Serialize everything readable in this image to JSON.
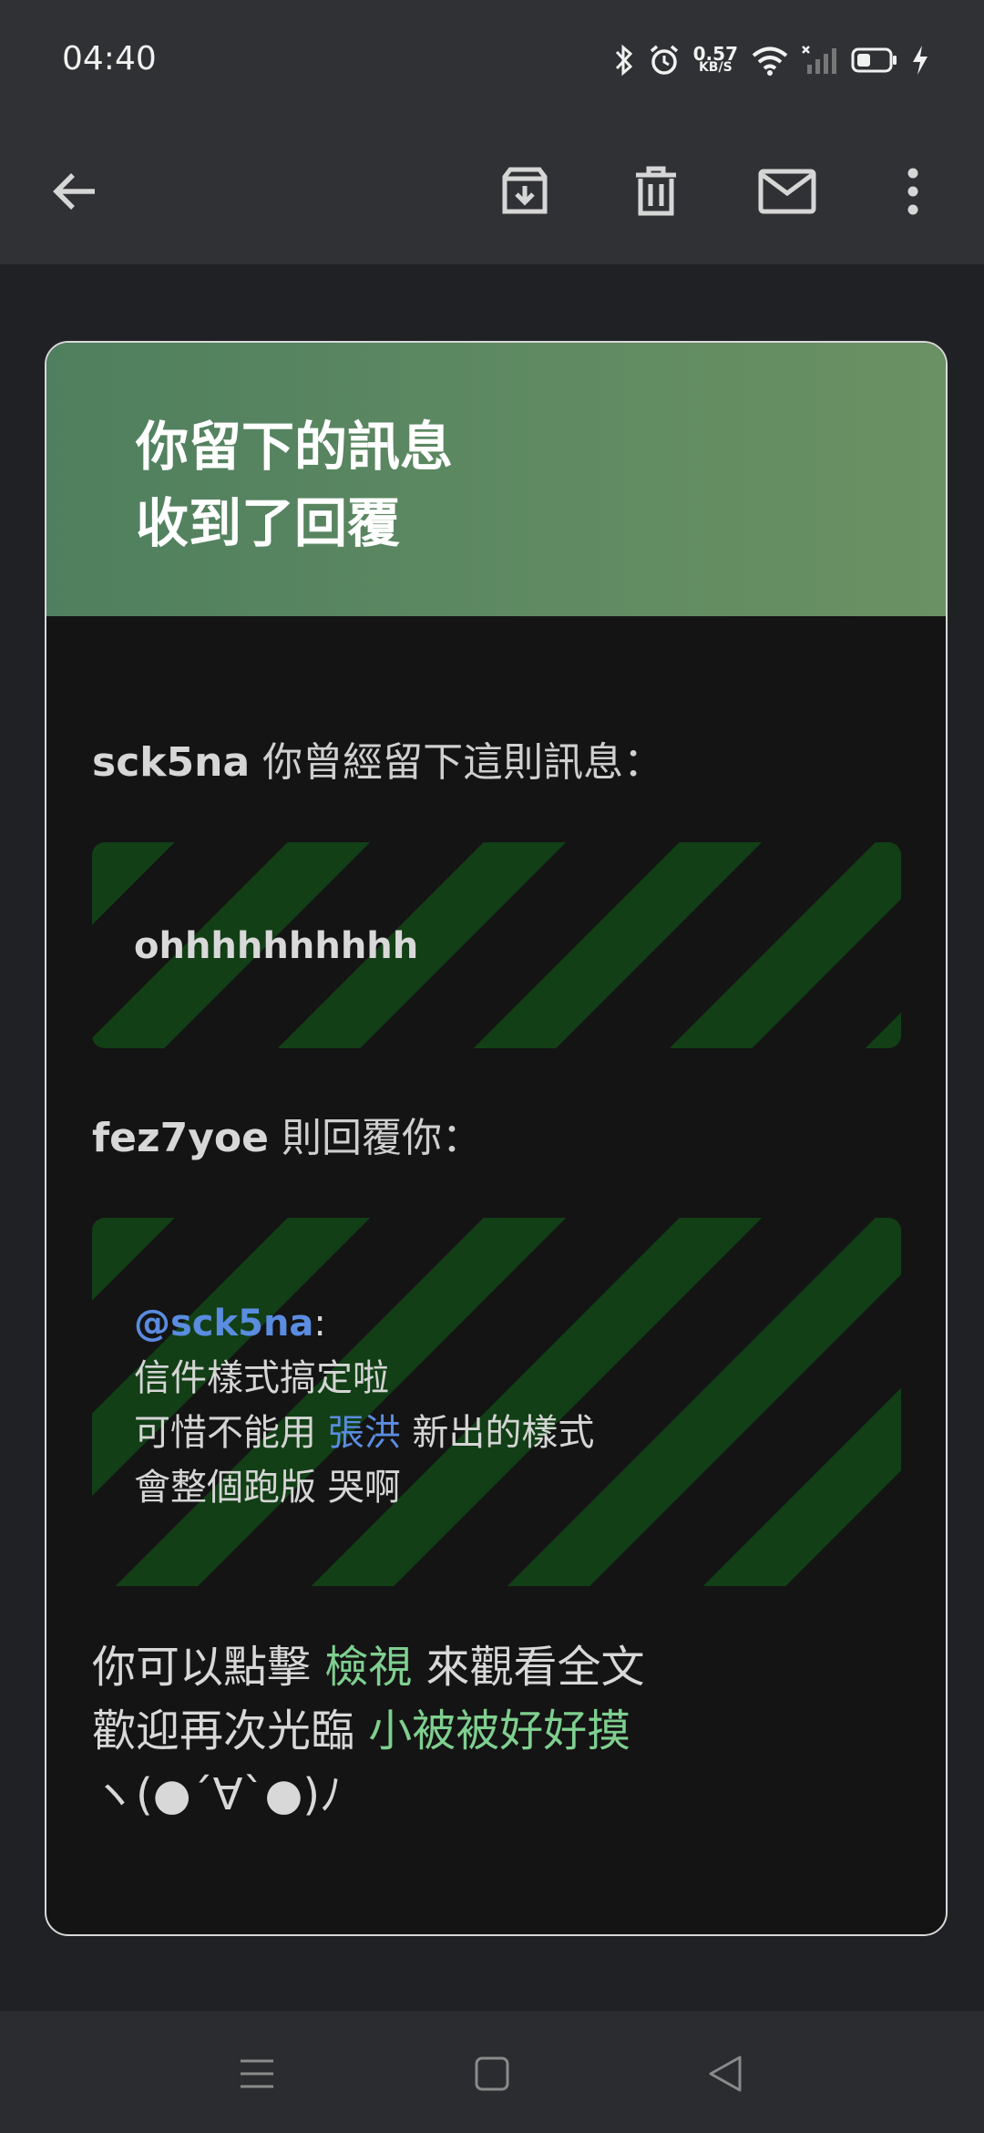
{
  "status": {
    "time": "04:40",
    "net_speed_value": "0.57",
    "net_speed_unit": "KB/S",
    "icons": [
      "bluetooth-icon",
      "alarm-icon",
      "wifi-icon",
      "signal-icon",
      "battery-icon",
      "charging-icon"
    ]
  },
  "toolbar": {
    "icons": [
      "back-arrow-icon",
      "archive-icon",
      "delete-icon",
      "mark-unread-icon",
      "more-vert-icon"
    ]
  },
  "email": {
    "header_title": "你留下的訊息\n收到了回覆",
    "original_author": "sck5na",
    "original_intro": " 你曾經留下這則訊息：",
    "original_message": "ohhhhhhhhhh",
    "reply_author": "fez7yoe",
    "reply_intro": " 則回覆你：",
    "reply_mention": "@sck5na",
    "reply_colon": ":",
    "reply_line1": "信件樣式搞定啦",
    "reply_line2_pre": "可惜不能用 ",
    "reply_line2_link": "張洪",
    "reply_line2_post": " 新出的樣式",
    "reply_line3": "會整個跑版 哭啊",
    "footer_line1_pre": "你可以點擊 ",
    "footer_line1_link": "檢視",
    "footer_line1_post": " 來觀看全文",
    "footer_line2_pre": "歡迎再次光臨 ",
    "footer_line2_link": "小被被好好摸",
    "footer_line3": "ヽ(●´∀`●)ﾉ"
  },
  "colors": {
    "header_green": "#5f8a62",
    "stripe_green": "#123f16",
    "link_blue": "#5a8ce0",
    "link_green": "#7fcf8f"
  },
  "navbar": {
    "icons": [
      "menu-icon",
      "home-square-icon",
      "back-triangle-icon"
    ]
  }
}
